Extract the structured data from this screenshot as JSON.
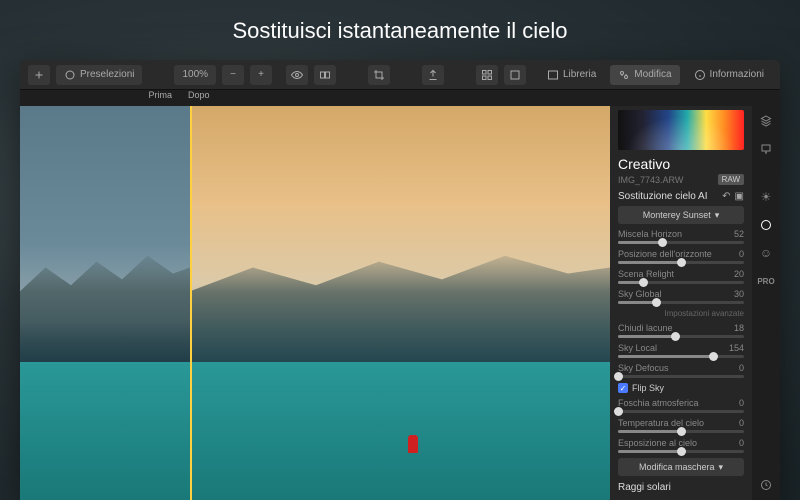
{
  "hero": "Sostituisci istantaneamente il cielo",
  "toolbar": {
    "presets": "Preselezioni",
    "zoom": "100%",
    "library": "Libreria",
    "edit": "Modifica",
    "info": "Informazioni"
  },
  "ba": {
    "before": "Prima",
    "after": "Dopo"
  },
  "panel": {
    "section": "Creativo",
    "filename": "IMG_7743.ARW",
    "filebadge": "RAW",
    "tool": "Sostituzione cielo AI",
    "preset": "Monterey Sunset",
    "sliders": [
      {
        "label": "Miscela Horizon",
        "val": 52,
        "pct": 35
      },
      {
        "label": "Posizione dell'orizzonte",
        "val": 0,
        "pct": 50
      },
      {
        "label": "Scena Relight",
        "val": 20,
        "pct": 20
      },
      {
        "label": "Sky Global",
        "val": 30,
        "pct": 30
      }
    ],
    "advanced": "Impostazioni avanzate",
    "sliders2": [
      {
        "label": "Chiudi lacune",
        "val": 18,
        "pct": 45
      },
      {
        "label": "Sky Local",
        "val": 154,
        "pct": 75
      }
    ],
    "sliders3": [
      {
        "label": "Sky Defocus",
        "val": 0,
        "pct": 0
      }
    ],
    "flip": "Flip Sky",
    "sliders4": [
      {
        "label": "Foschia atmosferica",
        "val": 0,
        "pct": 0
      },
      {
        "label": "Temperatura del cielo",
        "val": 0,
        "pct": 50
      },
      {
        "label": "Esposizione al cielo",
        "val": 0,
        "pct": 50
      }
    ],
    "maskbtn": "Modifica maschera",
    "raggi": "Raggi solari"
  },
  "rail": {
    "pro": "PRO"
  }
}
